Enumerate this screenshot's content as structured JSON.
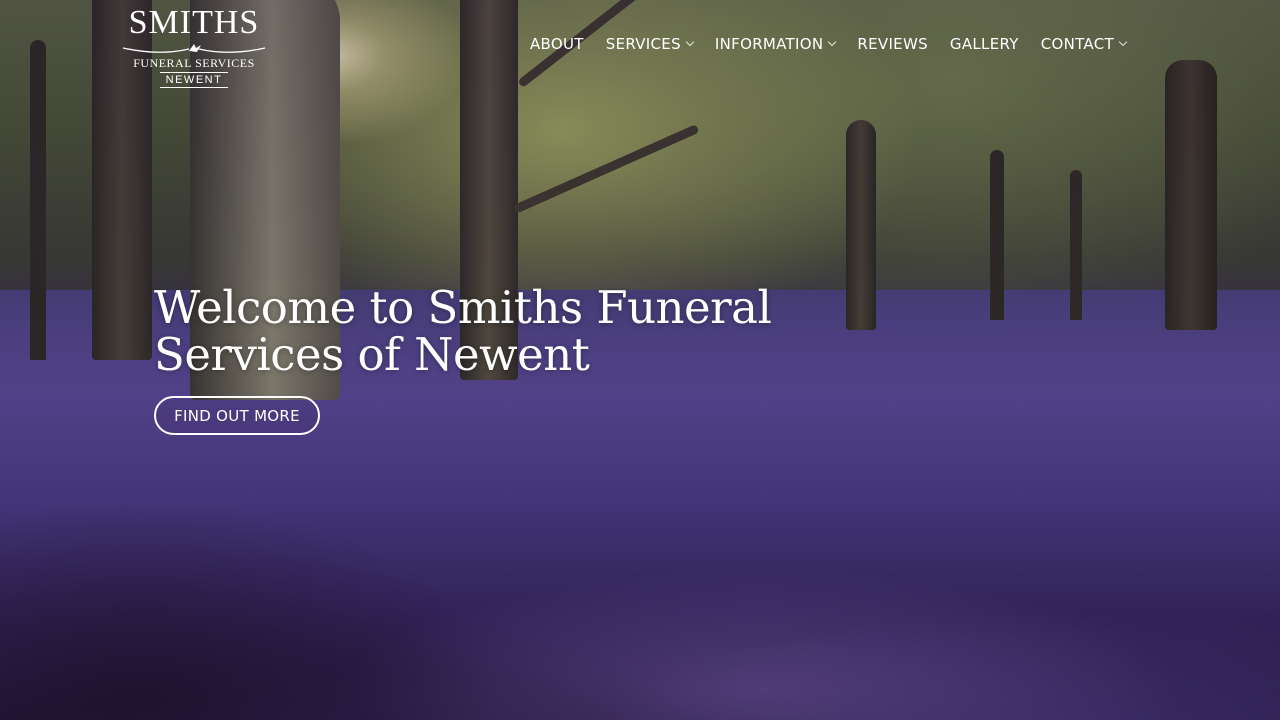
{
  "logo": {
    "main": "SMITHS",
    "sub": "FUNERAL SERVICES",
    "town": "NEWENT",
    "emblem": "dove-icon"
  },
  "nav": {
    "items": [
      {
        "label": "ABOUT",
        "has_dropdown": false
      },
      {
        "label": "SERVICES",
        "has_dropdown": true
      },
      {
        "label": "INFORMATION",
        "has_dropdown": true
      },
      {
        "label": "REVIEWS",
        "has_dropdown": false
      },
      {
        "label": "GALLERY",
        "has_dropdown": false
      },
      {
        "label": "CONTACT",
        "has_dropdown": true
      }
    ]
  },
  "hero": {
    "title": "Welcome to Smiths Funeral Services of Newent",
    "cta_label": "FIND OUT MORE",
    "background": "bluebell-woodland-photo"
  },
  "colors": {
    "text": "#ffffff",
    "overlay": "#28143c"
  }
}
